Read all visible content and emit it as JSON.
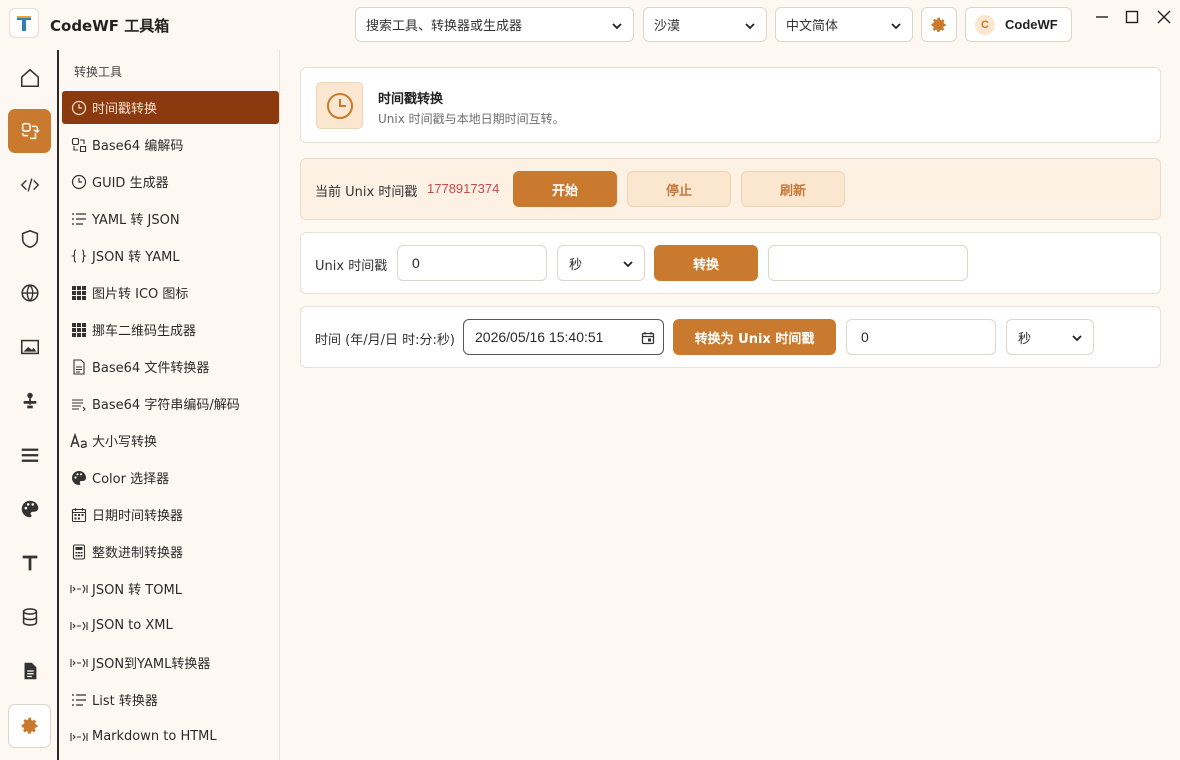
{
  "app": {
    "title": "CodeWF 工具箱"
  },
  "topbar": {
    "search_placeholder": "搜索工具、转换器或生成器",
    "theme": "沙漠",
    "language": "中文简体",
    "account_initial": "C",
    "account_name": "CodeWF"
  },
  "rail": {
    "items": [
      {
        "icon": "home-icon"
      },
      {
        "icon": "convert-icon",
        "active": true
      },
      {
        "icon": "code-icon"
      },
      {
        "icon": "shield-icon"
      },
      {
        "icon": "globe-icon"
      },
      {
        "icon": "image-icon"
      },
      {
        "icon": "joystick-icon"
      },
      {
        "icon": "list-icon"
      },
      {
        "icon": "palette-icon"
      },
      {
        "icon": "text-icon"
      },
      {
        "icon": "database-icon"
      },
      {
        "icon": "document-icon"
      },
      {
        "icon": "gear-icon"
      }
    ]
  },
  "sidebar": {
    "header": "转换工具",
    "items": [
      {
        "label": "时间戳转换",
        "icon": "clock-icon",
        "active": true
      },
      {
        "label": "Base64 编解码",
        "icon": "base64-icon"
      },
      {
        "label": "GUID 生成器",
        "icon": "clock-icon"
      },
      {
        "label": "YAML 转 JSON",
        "icon": "list-lines-icon"
      },
      {
        "label": "JSON 转 YAML",
        "icon": "braces-icon"
      },
      {
        "label": "图片转 ICO 图标",
        "icon": "grid-icon"
      },
      {
        "label": "挪车二维码生成器",
        "icon": "grid-icon"
      },
      {
        "label": "Base64 文件转换器",
        "icon": "file-icon"
      },
      {
        "label": "Base64 字符串编码/解码",
        "icon": "text-lines-icon"
      },
      {
        "label": "大小写转换",
        "icon": "font-case-icon"
      },
      {
        "label": "Color 选择器",
        "icon": "palette-icon"
      },
      {
        "label": "日期时间转换器",
        "icon": "calendar-icon"
      },
      {
        "label": "整数进制转换器",
        "icon": "calculator-icon"
      },
      {
        "label": "JSON 转 TOML",
        "icon": "convert-small-icon"
      },
      {
        "label": "JSON to XML",
        "icon": "convert-small-icon"
      },
      {
        "label": "JSON到YAML转换器",
        "icon": "convert-small-icon"
      },
      {
        "label": "List 转换器",
        "icon": "list-lines-icon"
      },
      {
        "label": "Markdown to HTML",
        "icon": "convert-small-icon"
      }
    ]
  },
  "tool": {
    "title": "时间戳转换",
    "description": "Unix 时间戳与本地日期时间互转。"
  },
  "current": {
    "label": "当前 Unix 时间戳",
    "timestamp": "1778917374",
    "start": "开始",
    "stop": "停止",
    "refresh": "刷新"
  },
  "unix_row": {
    "label": "Unix 时间戳",
    "value": "0",
    "unit": "秒",
    "convert": "转换",
    "result": ""
  },
  "date_row": {
    "label": "时间 (年/月/日 时:分:秒)",
    "value": "2026/05/16 15:40:51",
    "convert": "转换为 Unix 时间戳",
    "result": "0",
    "unit": "秒"
  },
  "colors": {
    "accent": "#c97a2e",
    "active_item": "#8b3a0f",
    "background": "#fdf8f1",
    "timestamp": "#c44a4a"
  }
}
